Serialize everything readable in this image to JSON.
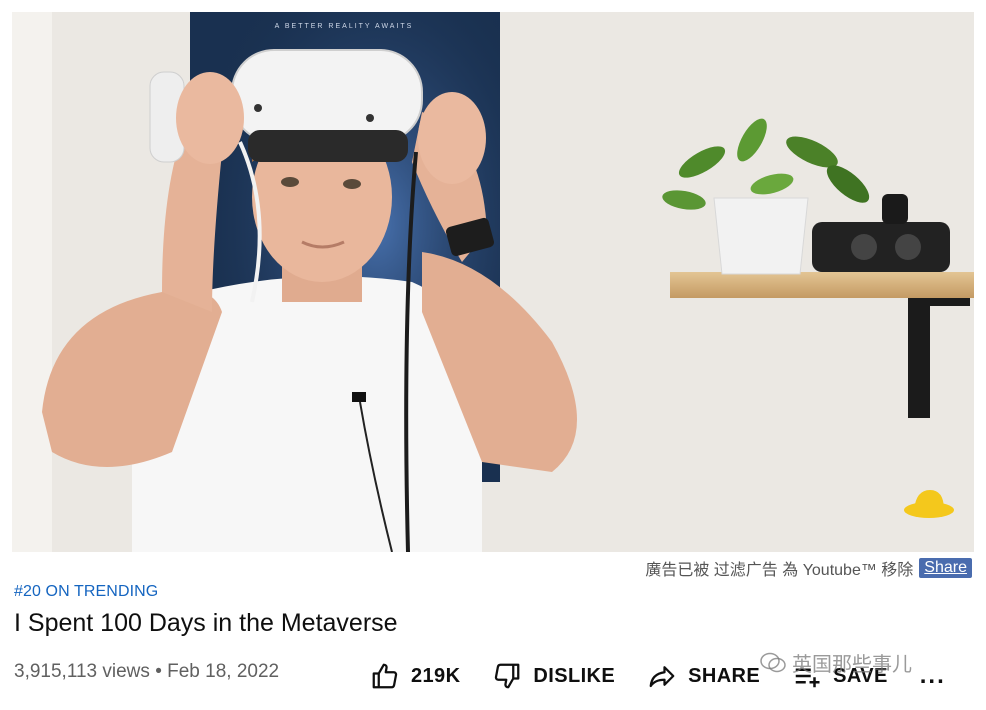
{
  "video": {
    "poster_caption": "A BETTER REALITY AWAITS"
  },
  "ad_notice": {
    "text": "廣告已被 过滤广告 為 Youtube™ 移除",
    "share_label": "Share"
  },
  "trending_label": "#20 ON TRENDING",
  "title": "I Spent 100 Days in the Metaverse",
  "views": "3,915,113 views",
  "separator": "•",
  "date": "Feb 18, 2022",
  "actions": {
    "like_count": "219K",
    "dislike_label": "DISLIKE",
    "share_label": "SHARE",
    "save_label": "SAVE",
    "more_label": "..."
  },
  "watermark": {
    "text": "英国那些事儿"
  },
  "icons": {
    "like": "thumbs-up-icon",
    "dislike": "thumbs-down-icon",
    "share": "share-arrow-icon",
    "save": "playlist-add-icon",
    "more": "more-dots-icon"
  }
}
